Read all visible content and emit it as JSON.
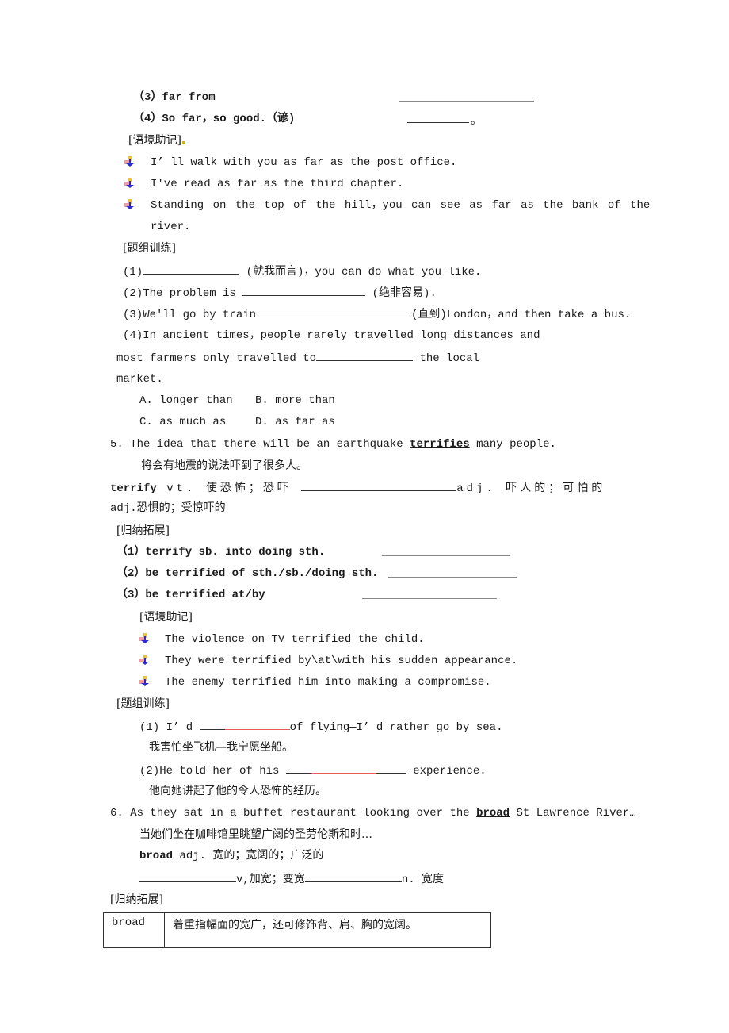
{
  "section4_tail": {
    "item3": "（3）far from",
    "item4": "（4）So far，so good.（谚)",
    "item4_suffix": "。",
    "context_heading": "[语境助记]",
    "examples": [
      "I’ ll walk with you as far as the post office.",
      "I've read as far as the third chapter.",
      "Standing on the top of the hill，you can see as far as the bank of the",
      "river."
    ],
    "practice_heading": "[题组训练]",
    "practice": {
      "q1_prefix": "(1)",
      "q1_suffix": " (就我而言)，you can do what you like.",
      "q2_prefix": "(2)The problem is ",
      "q2_suffix": "  (绝非容易).",
      "q3_prefix": "(3)We'll go by train",
      "q3_suffix": "(直到)London，and then take a bus.",
      "q4_line1": "(4)In ancient times，people rarely travelled long distances and",
      "q4_line2_prefix": "most farmers only travelled to",
      "q4_line2_suffix": "  the local",
      "q4_line3": "market.",
      "options": [
        "A. longer than",
        "B. more than",
        "C. as much as",
        "D. as far as"
      ]
    }
  },
  "section5": {
    "sentence_prefix": "5. The idea that there will be an earthquake ",
    "keyword": "terrifies",
    "sentence_suffix": " many people.",
    "translation": "将会有地震的说法吓到了很多人。",
    "word": "terrify",
    "def_part1": "  vt. 使恐怖；恐吓 ",
    "def_part2": "adj. 吓人的；可怕的",
    "def_line2": "adj.恐惧的；受惊吓的",
    "extend_heading": "[归纳拓展]",
    "extend_items": [
      "（1）terrify sb. into doing sth.",
      "（2）be terrified of sth./sb./doing sth.",
      "（3）be terrified at/by"
    ],
    "context_heading": "[语境助记]",
    "examples": [
      "The violence on TV terrified the child.",
      "They were terrified by\\at\\with his sudden appearance.",
      "The enemy terrified him into making a compromise."
    ],
    "practice_heading": "[题组训练]",
    "q1_prefix": "(1) I’ d ",
    "q1_suffix": "of flying—I’ d rather go by sea.",
    "q1_translation": "我害怕坐飞机—我宁愿坐船。",
    "q2_prefix": "(2)He told her of his ",
    "q2_suffix": " experience.",
    "q2_translation": "他向她讲起了他的令人恐怖的经历。"
  },
  "section6": {
    "sentence_prefix": "6. As they sat in a buffet restaurant looking over the ",
    "keyword": "broad",
    "sentence_suffix": " St Lawrence River…",
    "translation": "当她们坐在咖啡馆里眺望广阔的圣劳伦斯和时…",
    "word": "broad",
    "def": "  adj. 宽的；宽阔的；广泛的",
    "deriv_v": "v,加宽；变宽",
    "deriv_n": "n. 宽度",
    "extend_heading": "[归纳拓展]",
    "table": [
      [
        "broad",
        "着重指幅面的宽广，还可修饰背、肩、胸的宽阔。"
      ]
    ]
  },
  "colors": {
    "text": "#1a1a1a",
    "blank_red": "#e85a5a",
    "bullet_yellow": "#f2c230",
    "bullet_red": "#e8606a",
    "bullet_blue": "#2a2ad0"
  }
}
